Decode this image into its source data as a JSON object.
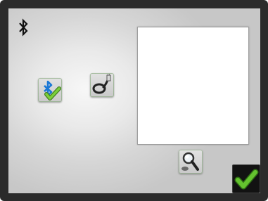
{
  "screen": {
    "status_icons": [
      "bluetooth-icon"
    ],
    "buttons": [
      {
        "name": "bluetooth-connect-button",
        "icon": "bluetooth-check-icon"
      },
      {
        "name": "cable-connect-button",
        "icon": "cable-icon"
      },
      {
        "name": "search-button",
        "icon": "magnifier-icon"
      },
      {
        "name": "confirm-button",
        "icon": "checkmark-icon"
      }
    ],
    "display_panel": {
      "content": ""
    }
  },
  "colors": {
    "frame": "#2b2b2b",
    "background": "#e2e2e2",
    "bluetooth": "#1a78d6",
    "check_green": "#58b82a",
    "panel": "#ffffff",
    "confirm_bg": "#121212"
  }
}
